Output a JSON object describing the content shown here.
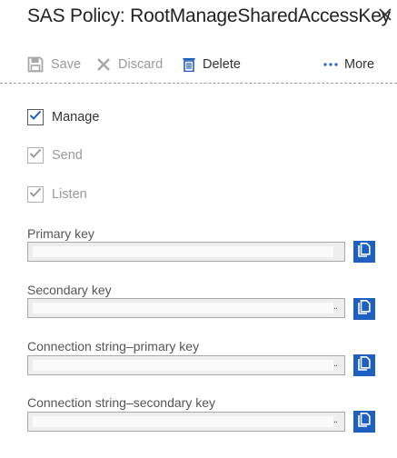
{
  "panel": {
    "title": "SAS Policy: RootManageSharedAccessKey"
  },
  "toolbar": {
    "save_label": "Save",
    "discard_label": "Discard",
    "delete_label": "Delete",
    "more_label": "More"
  },
  "claims": [
    {
      "label": "Manage",
      "checked": true,
      "enabled": true
    },
    {
      "label": "Send",
      "checked": true,
      "enabled": false
    },
    {
      "label": "Listen",
      "checked": true,
      "enabled": false
    }
  ],
  "keys": [
    {
      "label": "Primary key",
      "value": ""
    },
    {
      "label": "Secondary key",
      "value": ""
    },
    {
      "label": "Connection string–primary key",
      "value": ""
    },
    {
      "label": "Connection string–secondary key",
      "value": ""
    }
  ],
  "colors": {
    "accent": "#1e5fc2",
    "disabled_text": "#9a9a9a"
  },
  "icons": {
    "save": "save-icon",
    "discard": "discard-icon",
    "delete": "delete-icon",
    "more": "more-icon",
    "close": "close-icon",
    "copy": "copy-icon",
    "check": "checkmark-icon"
  }
}
